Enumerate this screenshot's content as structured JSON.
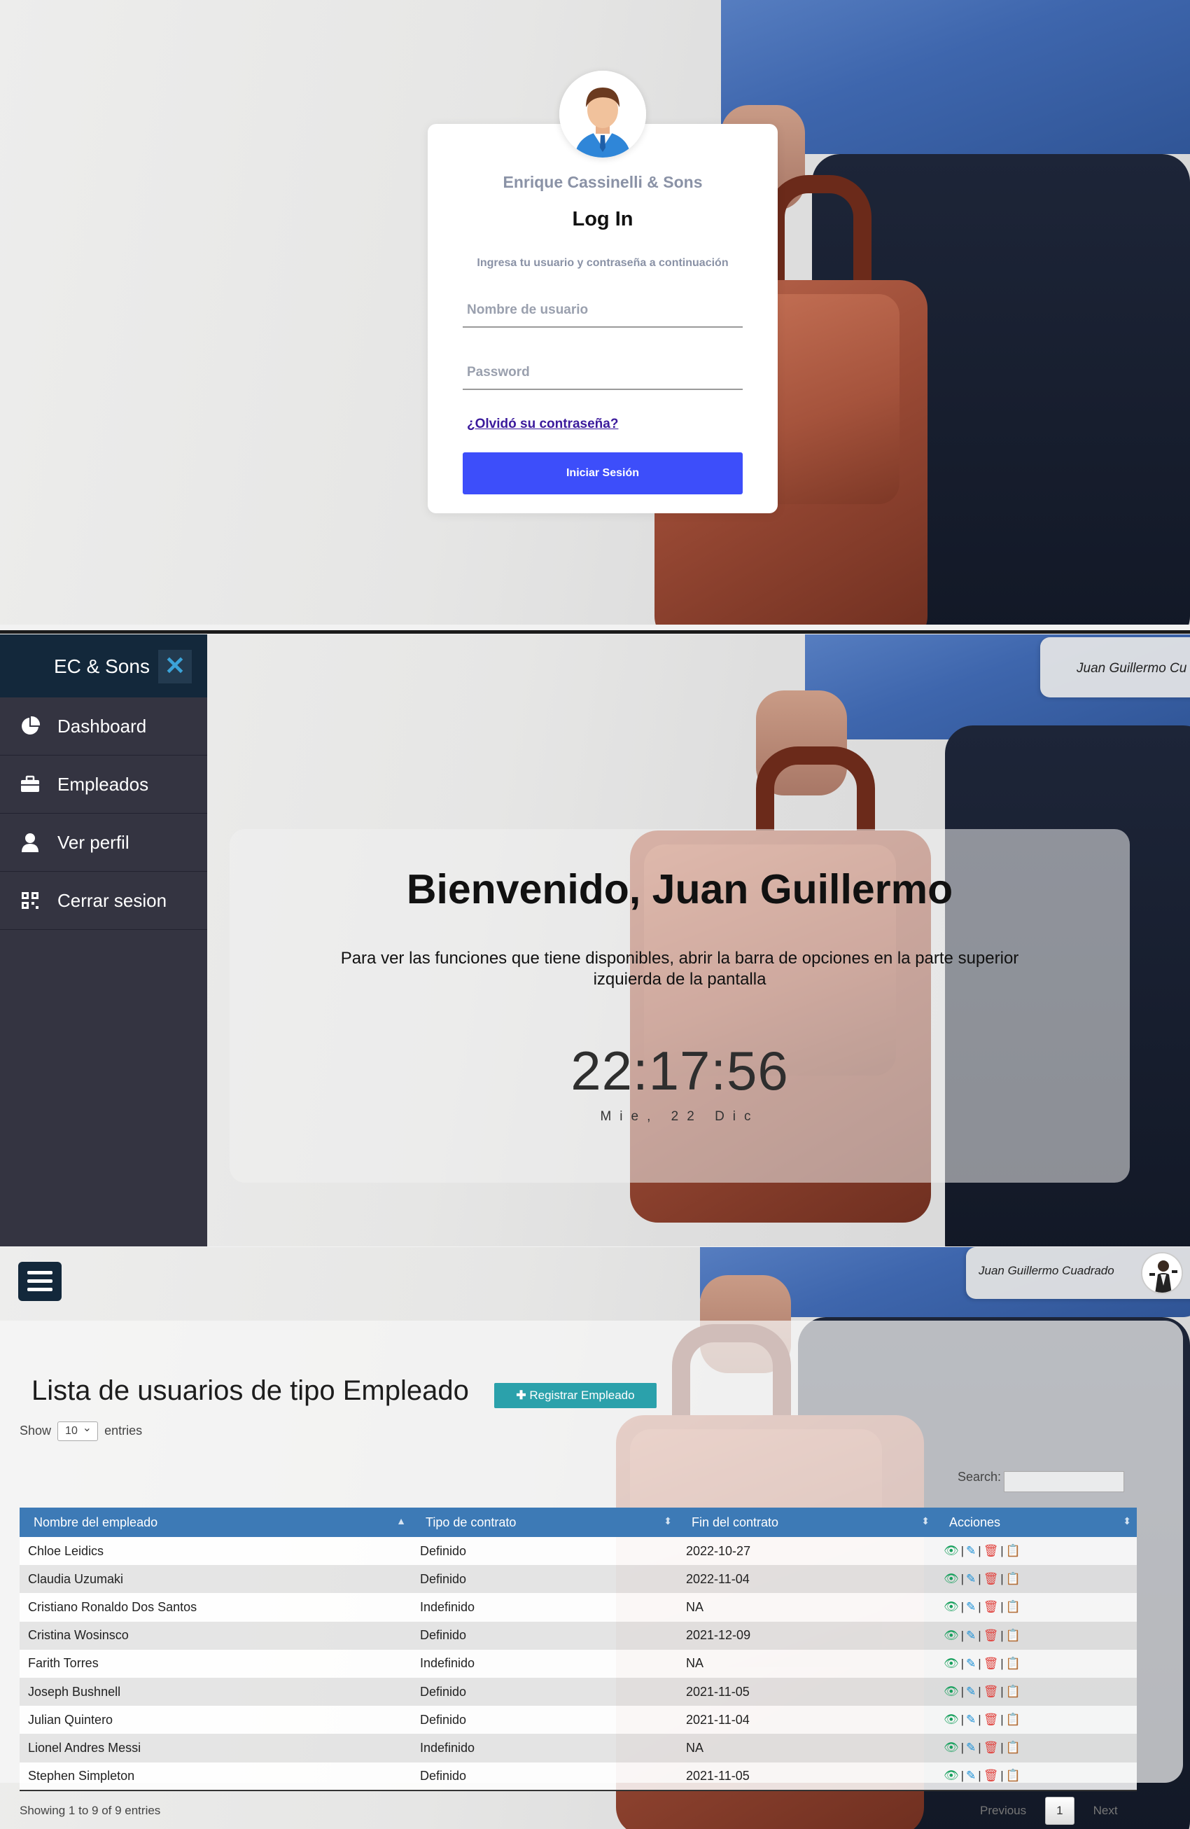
{
  "login": {
    "company": "Enrique Cassinelli & Sons",
    "title": "Log In",
    "subtitle": "Ingresa tu usuario y contraseña a continuación",
    "username_placeholder": "Nombre de usuario",
    "password_placeholder": "Password",
    "forgot_link": "¿Olvidó su contraseña?",
    "submit_label": "Iniciar Sesión"
  },
  "dashboard": {
    "brand": "EC & Sons",
    "close_icon": "close-icon",
    "nav": [
      {
        "label": "Dashboard",
        "icon": "pie-chart-icon"
      },
      {
        "label": "Empleados",
        "icon": "briefcase-icon"
      },
      {
        "label": "Ver perfil",
        "icon": "user-icon"
      },
      {
        "label": "Cerrar sesion",
        "icon": "qr-icon"
      }
    ],
    "user_name_partial": "Juan Guillermo Cu",
    "welcome_title": "Bienvenido, Juan Guillermo",
    "welcome_text": "Para ver las funciones que tiene disponibles, abrir la barra de opciones en la parte superior izquierda de la pantalla",
    "clock_time": "22:17:56",
    "clock_date": "Mie, 22 Dic"
  },
  "employees": {
    "user_name": "Juan Guillermo Cuadrado",
    "title": "Lista de usuarios de tipo Empleado",
    "register_label": "Registrar Empleado",
    "show_label": "Show",
    "show_value": "10",
    "entries_label": "entries",
    "search_label": "Search:",
    "columns": [
      "Nombre del empleado",
      "Tipo de contrato",
      "Fin del contrato",
      "Acciones"
    ],
    "rows": [
      [
        "Chloe Leidics",
        "Definido",
        "2022-10-27"
      ],
      [
        "Claudia Uzumaki",
        "Definido",
        "2022-11-04"
      ],
      [
        "Cristiano Ronaldo Dos Santos",
        "Indefinido",
        "NA"
      ],
      [
        "Cristina Wosinsco",
        "Definido",
        "2021-12-09"
      ],
      [
        "Farith Torres",
        "Indefinido",
        "NA"
      ],
      [
        "Joseph Bushnell",
        "Definido",
        "2021-11-05"
      ],
      [
        "Julian Quintero",
        "Definido",
        "2021-11-04"
      ],
      [
        "Lionel Andres Messi",
        "Indefinido",
        "NA"
      ],
      [
        "Stephen Simpleton",
        "Definido",
        "2021-11-05"
      ]
    ],
    "action_icons": [
      "eye-icon",
      "edit-icon",
      "trash-icon",
      "clipboard-icon"
    ],
    "showing_text": "Showing 1 to 9 of 9 entries",
    "pager": {
      "previous": "Previous",
      "page": "1",
      "next": "Next"
    },
    "colors": {
      "header": "#3d7ab6",
      "register_button": "#2ba1ab",
      "view": "#17a05d",
      "edit": "#1a8fd6",
      "delete": "#e0433e"
    }
  }
}
